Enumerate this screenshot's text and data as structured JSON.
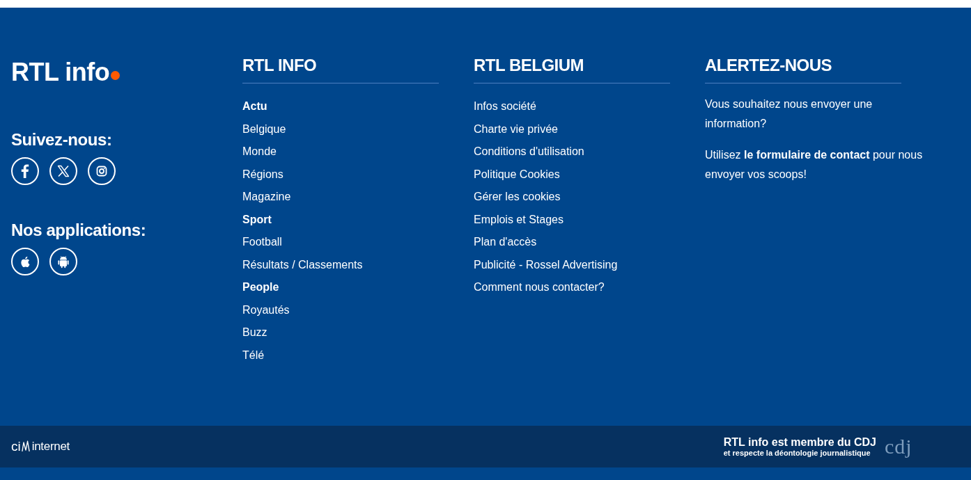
{
  "brand": {
    "logo_text": "RTL info"
  },
  "follow": {
    "title": "Suivez-nous:"
  },
  "apps": {
    "title": "Nos applications:"
  },
  "columns": [
    {
      "title": "RTL INFO",
      "links": [
        {
          "label": "Actu",
          "kind": "section"
        },
        {
          "label": "Belgique",
          "kind": "link"
        },
        {
          "label": "Monde",
          "kind": "link"
        },
        {
          "label": "Régions",
          "kind": "link"
        },
        {
          "label": "Magazine",
          "kind": "link"
        },
        {
          "label": "Sport",
          "kind": "section"
        },
        {
          "label": "Football",
          "kind": "link"
        },
        {
          "label": "Résultats / Classements",
          "kind": "link"
        },
        {
          "label": "People",
          "kind": "section"
        },
        {
          "label": "Royautés",
          "kind": "link"
        },
        {
          "label": "Buzz",
          "kind": "link"
        },
        {
          "label": "Télé",
          "kind": "link"
        }
      ]
    },
    {
      "title": "RTL BELGIUM",
      "links": [
        {
          "label": "Infos société",
          "kind": "link"
        },
        {
          "label": "Charte vie privée",
          "kind": "link"
        },
        {
          "label": "Conditions d'utilisation",
          "kind": "link"
        },
        {
          "label": "Politique Cookies",
          "kind": "link"
        },
        {
          "label": "Gérer les cookies",
          "kind": "link"
        },
        {
          "label": "Emplois et Stages",
          "kind": "link"
        },
        {
          "label": "Plan d'accès",
          "kind": "link"
        },
        {
          "label": "Publicité - Rossel Advertising",
          "kind": "link"
        },
        {
          "label": "Comment nous contacter?",
          "kind": "link"
        }
      ]
    }
  ],
  "alert": {
    "title": "ALERTEZ-NOUS",
    "paragraphs": [
      "Vous souhaitez nous envoyer une information?",
      "Utilisez **le formulaire de contact** pour nous envoyer vos scoops!"
    ]
  },
  "bottom_bar": {
    "cim_logo": {
      "prefix": "ci",
      "suffix": "internet"
    },
    "cdj_notice": {
      "title": "RTL info est membre du CDJ",
      "subtitle": "et respecte la déontologie journalistique"
    },
    "cdj_logo": {
      "text": "cdj"
    }
  }
}
